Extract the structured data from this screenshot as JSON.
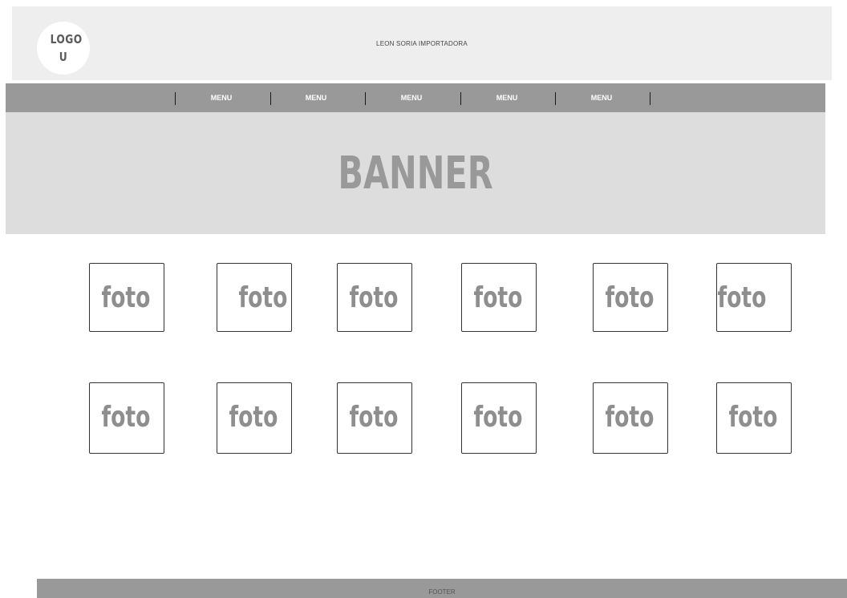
{
  "header": {
    "logo_text": "LOGO U",
    "company_name": "LEON SORIA IMPORTADORA"
  },
  "nav": {
    "items": [
      "MENU",
      "MENU",
      "MENU",
      "MENU",
      "MENU"
    ]
  },
  "banner": {
    "text": "BANNER"
  },
  "gallery": {
    "row1": [
      "foto",
      "foto",
      "foto",
      "foto",
      "foto",
      "foto"
    ],
    "row2": [
      "foto",
      "foto",
      "foto",
      "foto",
      "foto",
      "foto"
    ]
  },
  "footer": {
    "text": "FOOTER"
  },
  "colors": {
    "header_bg": "#eeeeee",
    "nav_bg": "#999999",
    "banner_bg": "#dddddd",
    "placeholder_text": "#8e8e8e"
  }
}
